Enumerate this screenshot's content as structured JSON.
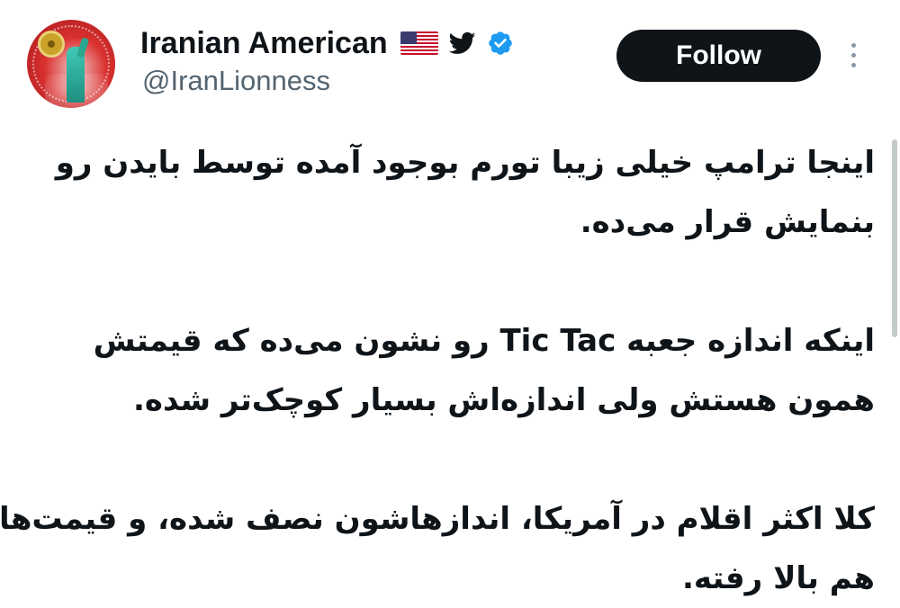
{
  "author": {
    "display_name": "Iranian American",
    "handle": "@IranLionness",
    "flag_icon": "us-flag-icon",
    "bird_icon": "twitter-bird-icon",
    "verified_icon": "verified-badge-icon",
    "verified_color": "#1d9bf0"
  },
  "actions": {
    "follow_label": "Follow",
    "more_icon": "more-vertical-icon"
  },
  "tweet": {
    "lines": [
      "اینجا ترامپ خیلی زیبا تورم بوجود آمده توسط بایدن رو",
      "بنمایش قرار می‌ده.",
      "اینکه اندازه جعبه Tic Tac رو نشون می‌ده که قیمتش",
      "همون هستش ولی اندازه‌اش بسیار کوچک‌تر شده.",
      "کلا اکثر اقلام در آمریکا، اندازهاشون نصف شده، و قیمت‌ها",
      "هم بالا رفته."
    ]
  },
  "colors": {
    "text": "#0f1419",
    "secondary_text": "#536471",
    "follow_bg": "#0f1419",
    "follow_text": "#ffffff"
  }
}
